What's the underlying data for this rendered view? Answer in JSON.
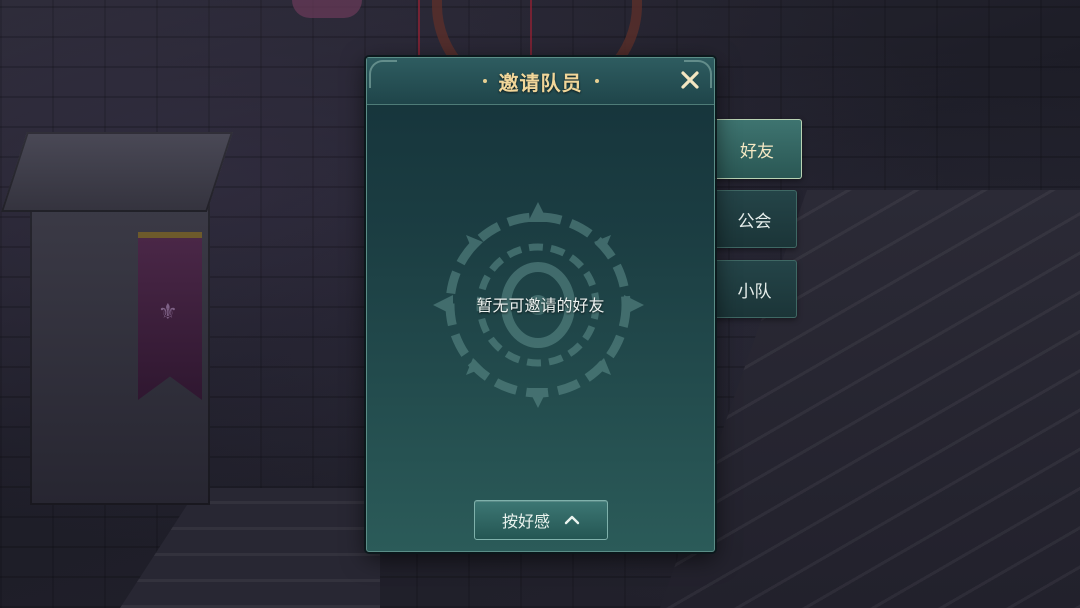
{
  "dialog": {
    "title": "邀请队员",
    "close_icon": "close-icon",
    "empty_message": "暂无可邀请的好友",
    "sort_button": {
      "label": "按好感",
      "icon": "chevron-up-icon"
    }
  },
  "tabs": [
    {
      "label": "好友",
      "active": true
    },
    {
      "label": "公会",
      "active": false
    },
    {
      "label": "小队",
      "active": false
    }
  ],
  "colors": {
    "title_gold": "#f2d79a",
    "panel_teal": "#1b3d42",
    "accent": "#3d7774"
  }
}
